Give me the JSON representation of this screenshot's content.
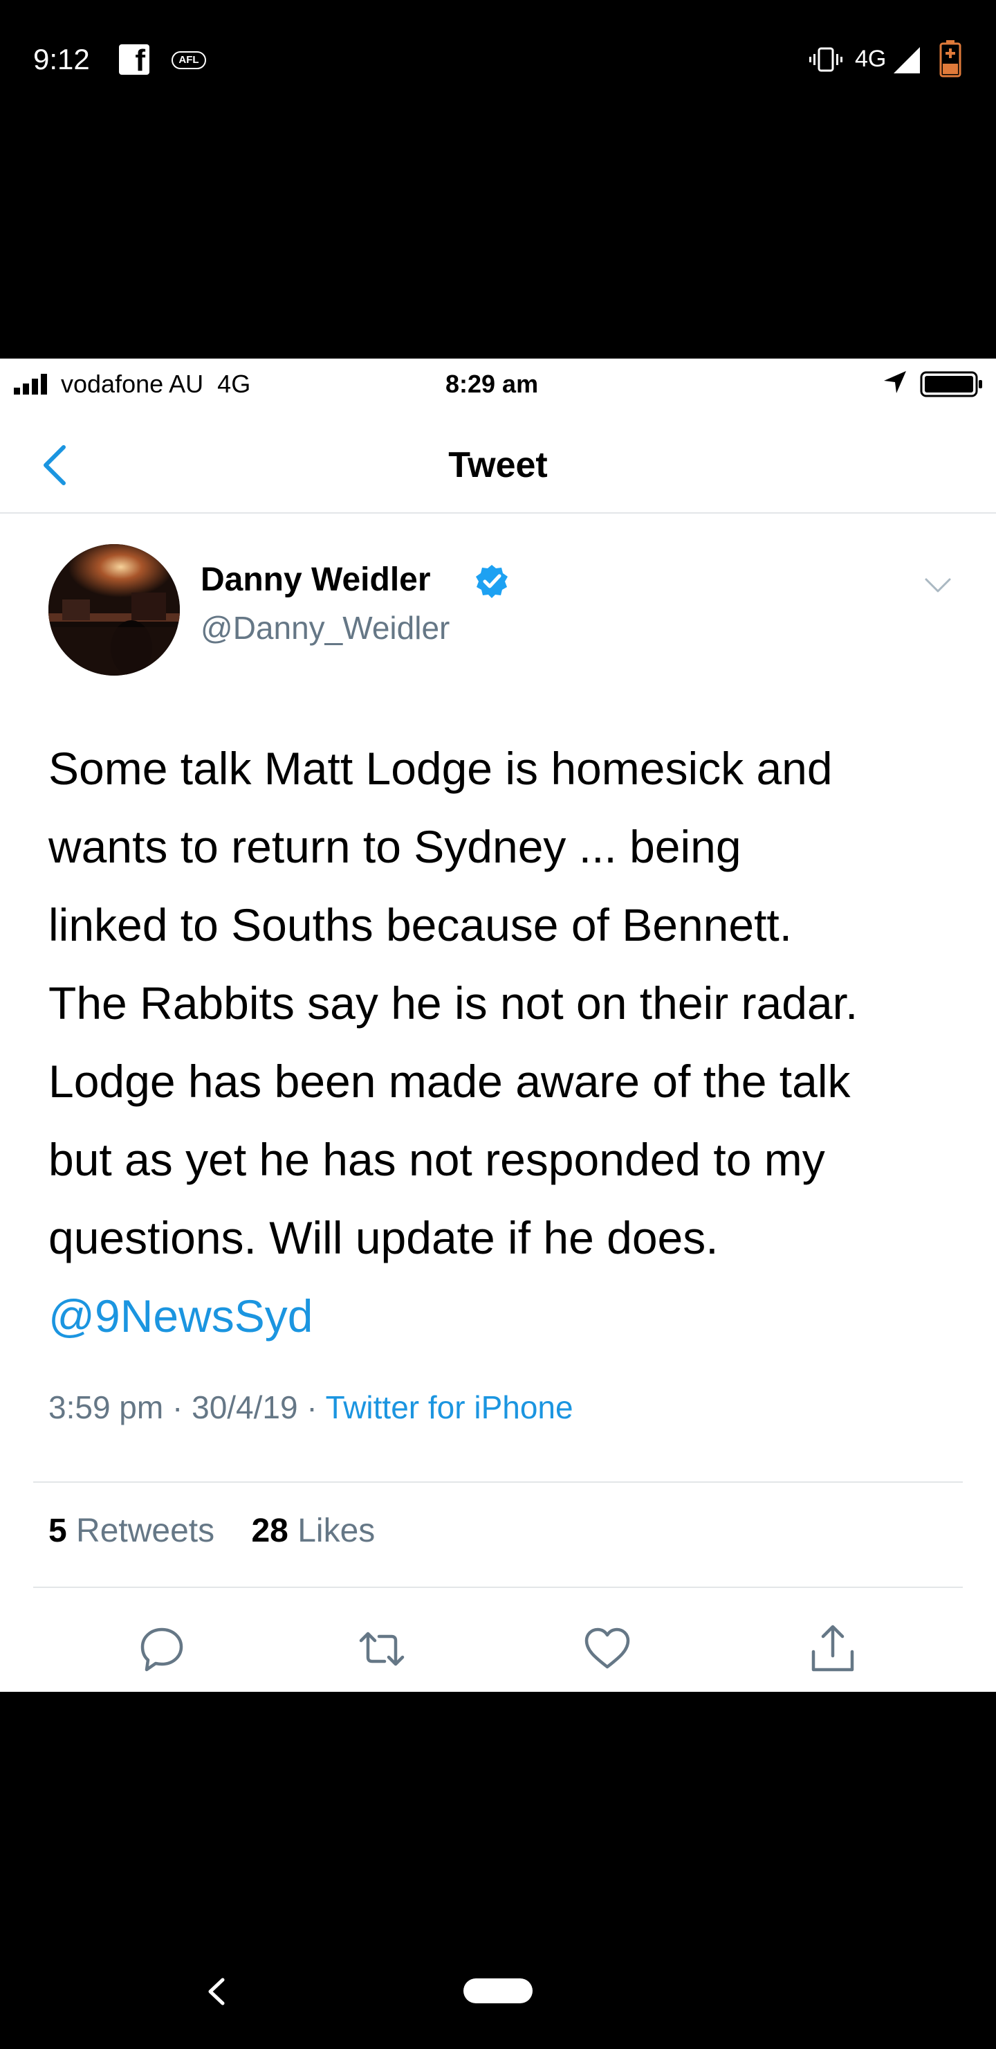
{
  "android_status": {
    "time": "9:12",
    "app_icons": [
      "facebook-icon",
      "afl-icon"
    ],
    "afl_label": "AFL",
    "network": "4G",
    "status_icons": [
      "vibrate-icon",
      "signal-icon",
      "battery-icon"
    ]
  },
  "ios_status": {
    "carrier": "vodafone AU",
    "network": "4G",
    "time": "8:29 am"
  },
  "nav": {
    "title": "Tweet",
    "back_icon": "chevron-left-icon"
  },
  "tweet": {
    "author_name": "Danny Weidler",
    "author_handle": "@Danny_Weidler",
    "verified": true,
    "lines": [
      "Some talk Matt Lodge is homesick and",
      "wants to return to Sydney ... being",
      "linked to Souths because of Bennett.",
      "The Rabbits say he is not on their radar.",
      "Lodge has been made aware of the talk",
      "but as yet he has not responded to my",
      "questions. Will update if he does."
    ],
    "mention": "@9NewsSyd",
    "time": "3:59 pm",
    "date": "30/4/19",
    "source": "Twitter for iPhone",
    "retweets_count": "5",
    "retweets_label": "Retweets",
    "likes_count": "28",
    "likes_label": "Likes"
  },
  "colors": {
    "link": "#1b95e0",
    "secondary_text": "#657786",
    "divider": "#e3e6e8"
  }
}
